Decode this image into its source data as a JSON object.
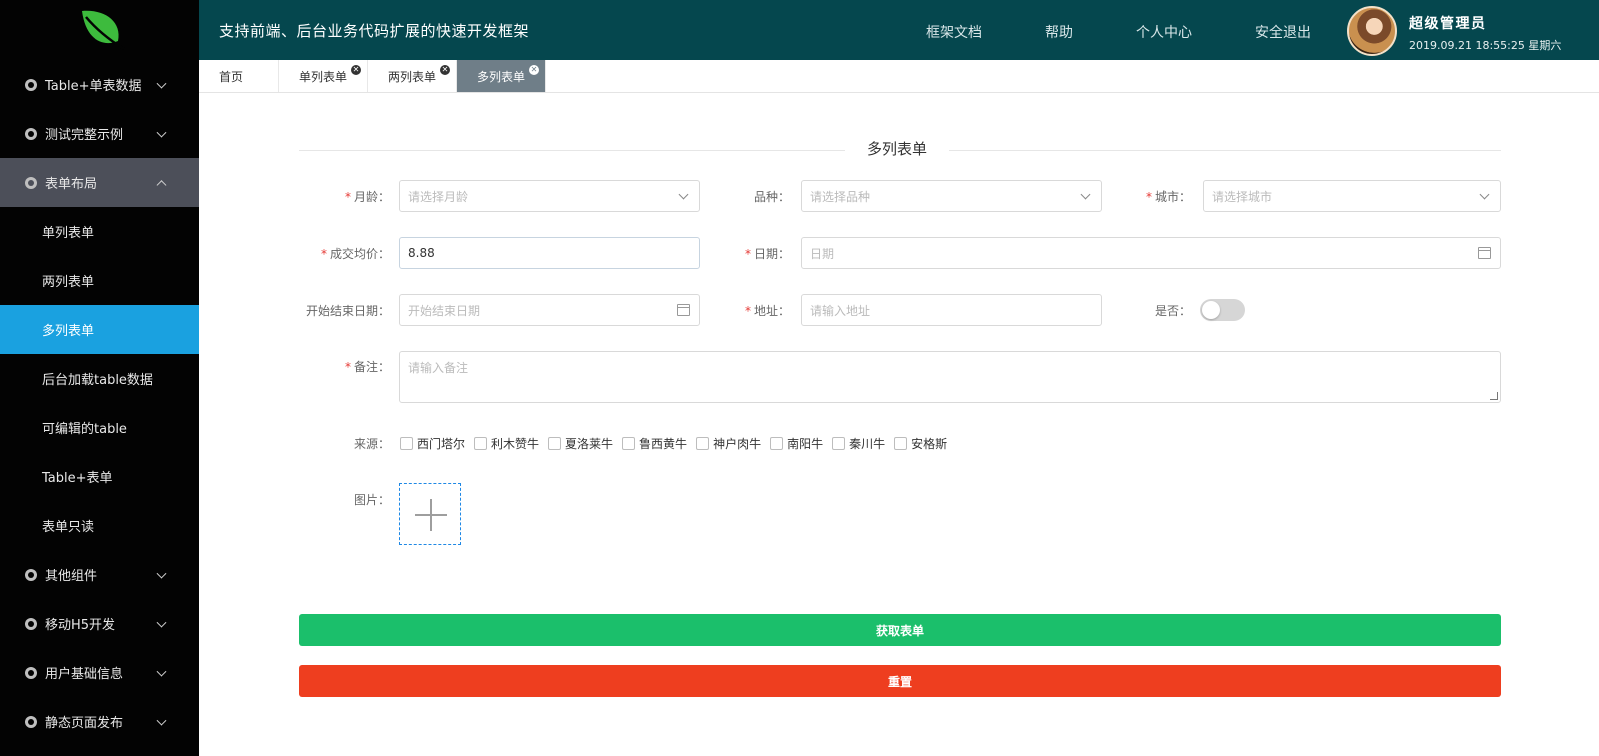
{
  "header": {
    "title": "支持前端、后台业务代码扩展的快速开发框架",
    "nav": [
      "框架文档",
      "帮助",
      "个人中心",
      "安全退出"
    ],
    "user_name": "超级管理员",
    "datetime": "2019.09.21 18:55:25 星期六"
  },
  "sidebar": {
    "groups_top": [
      {
        "label": "Table+单表数据"
      },
      {
        "label": "测试完整示例"
      },
      {
        "label": "表单布局"
      }
    ],
    "sub_items": [
      "单列表单",
      "两列表单",
      "多列表单",
      "后台加载table数据",
      "可编辑的table",
      "Table+表单",
      "表单只读"
    ],
    "groups_bottom": [
      {
        "label": "其他组件"
      },
      {
        "label": "移动H5开发"
      },
      {
        "label": "用户基础信息"
      },
      {
        "label": "静态页面发布"
      }
    ]
  },
  "tabs": [
    {
      "label": "首页"
    },
    {
      "label": "单列表单"
    },
    {
      "label": "两列表单"
    },
    {
      "label": "多列表单"
    }
  ],
  "form": {
    "title": "多列表单",
    "age_label": "月龄：",
    "age_placeholder": "请选择月龄",
    "breed_label": "品种：",
    "breed_placeholder": "请选择品种",
    "city_label": "城市：",
    "city_placeholder": "请选择城市",
    "price_label": "成交均价：",
    "price_value": "8.88",
    "date_label": "日期：",
    "date_placeholder": "日期",
    "range_label": "开始结束日期：",
    "range_placeholder": "开始结束日期",
    "address_label": "地址：",
    "address_placeholder": "请输入地址",
    "yesno_label": "是否：",
    "remark_label": "备注：",
    "remark_placeholder": "请输入备注",
    "source_label": "来源：",
    "sources": [
      "西门塔尔",
      "利木赞牛",
      "夏洛莱牛",
      "鲁西黄牛",
      "神户肉牛",
      "南阳牛",
      "秦川牛",
      "安格斯"
    ],
    "image_label": "图片：",
    "submit_label": "获取表单",
    "reset_label": "重置"
  },
  "colors": {
    "sidebar_bg": "#030303",
    "active_menu": "#1aa1e0",
    "header_bg": "#05474e",
    "submit": "#1bbf6b",
    "reset": "#ee3e1f"
  }
}
